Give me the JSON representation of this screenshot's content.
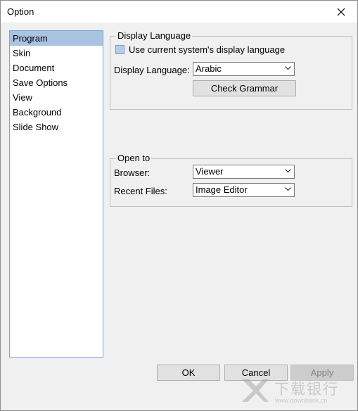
{
  "window": {
    "title": "Option"
  },
  "sidebar": {
    "items": [
      {
        "label": "Program"
      },
      {
        "label": "Skin"
      },
      {
        "label": "Document"
      },
      {
        "label": "Save Options"
      },
      {
        "label": "View"
      },
      {
        "label": "Background"
      },
      {
        "label": "Slide Show"
      }
    ],
    "selected_index": 0
  },
  "display_language_group": {
    "title": "Display Language",
    "use_system_checkbox": {
      "label": "Use current system's display language",
      "checked": false
    },
    "language_label": "Display Language:",
    "language_value": "Arabic",
    "check_grammar_button": "Check Grammar"
  },
  "open_to_group": {
    "title": "Open to",
    "browser_label": "Browser:",
    "browser_value": "Viewer",
    "recent_files_label": "Recent Files:",
    "recent_files_value": "Image Editor"
  },
  "buttons": {
    "ok": "OK",
    "cancel": "Cancel",
    "apply": "Apply"
  },
  "watermark": {
    "brand": "下载银行",
    "url": "www.downbank.cn"
  },
  "colors": {
    "selection": "#a9c3e0",
    "dialog_bg": "#f0f0f0",
    "sidebar_border": "#7aa5d6"
  }
}
